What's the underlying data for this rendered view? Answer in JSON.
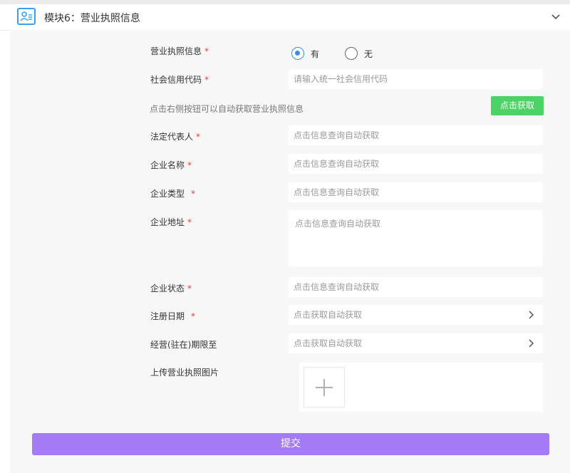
{
  "header": {
    "title": "模块6：营业执照信息",
    "icon": "id-card-icon",
    "toggle_icon": "chevron-down-icon"
  },
  "form": {
    "license_info": {
      "label": "营业执照信息",
      "options": [
        "有",
        "无"
      ],
      "selected": "有"
    },
    "credit_code": {
      "label": "社会信用代码",
      "placeholder": "请输入统一社会信用代码"
    },
    "hint": "点击右侧按钮可以自动获取营业执照信息",
    "fetch_button": "点击获取",
    "legal_rep": {
      "label": "法定代表人",
      "placeholder": "点击信息查询自动获取"
    },
    "company_name": {
      "label": "企业名称",
      "placeholder": "点击信息查询自动获取"
    },
    "company_type": {
      "label": "企业类型",
      "placeholder": "点击信息查询自动获取"
    },
    "company_address": {
      "label": "企业地址",
      "placeholder": "点击信息查询自动获取"
    },
    "company_status": {
      "label": "企业状态",
      "placeholder": "点击信息查询自动获取"
    },
    "reg_date": {
      "label": "注册日期",
      "placeholder": "点击获取自动获取"
    },
    "operating_period": {
      "label": "经营(驻在)期限至",
      "placeholder": "点击获取自动获取"
    },
    "upload": {
      "label": "上传营业执照图片",
      "icon": "plus-icon"
    },
    "required_mark": "*"
  },
  "submit_label": "提交",
  "colors": {
    "accent_blue": "#3a8ee6",
    "green_button": "#4cd265",
    "submit_purple": "#a57bf5",
    "required_red": "#e33b3b"
  }
}
